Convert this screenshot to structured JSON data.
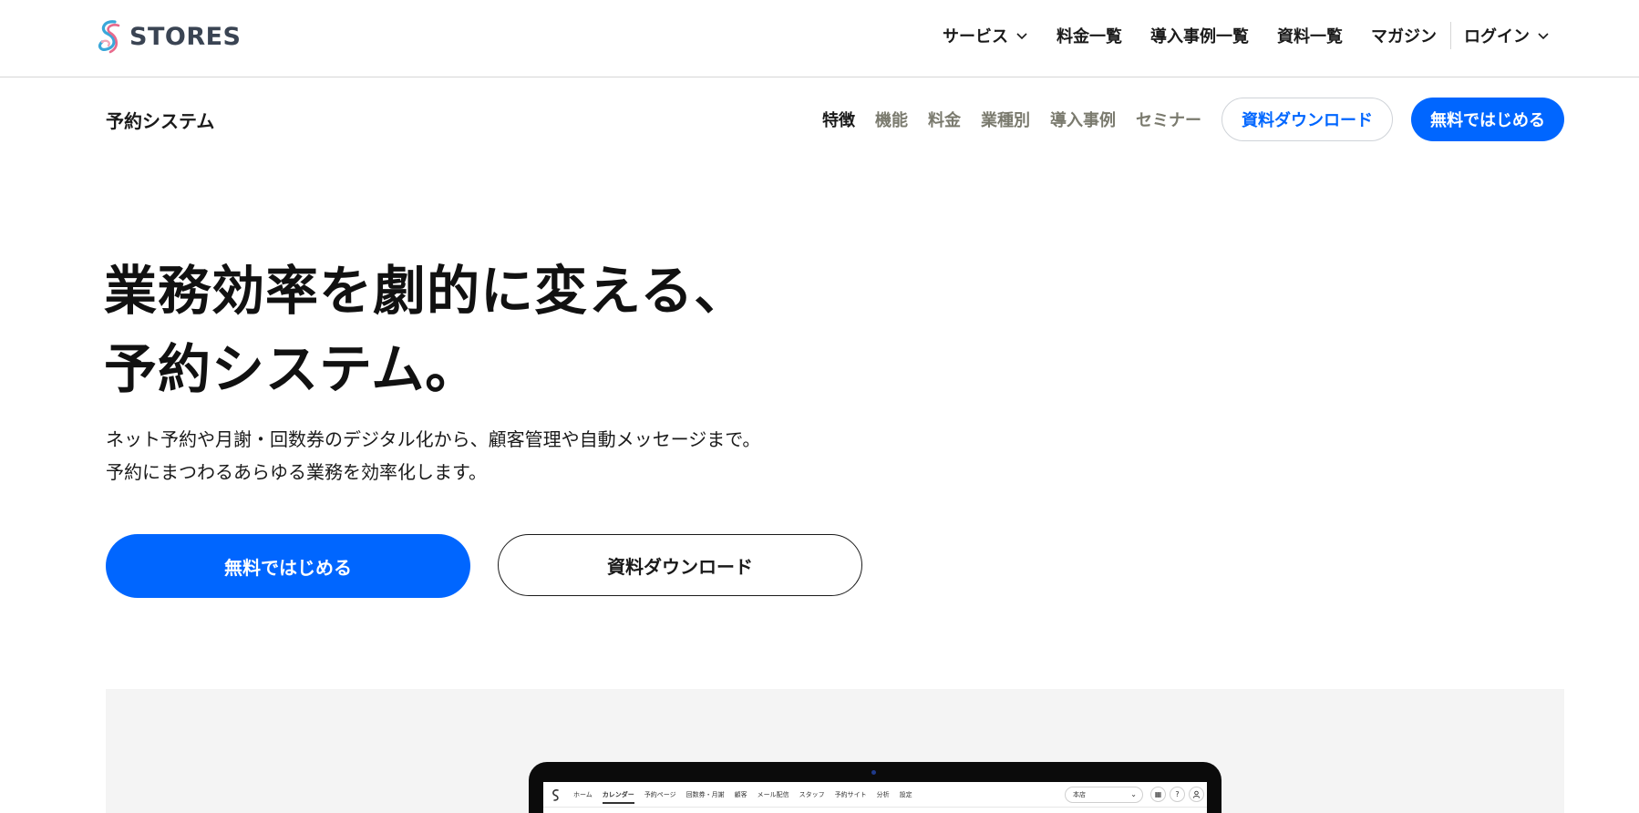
{
  "global_header": {
    "logo_text": "STORES",
    "nav": {
      "service": "サービス",
      "pricing": "料金一覧",
      "cases": "導入事例一覧",
      "documents": "資料一覧",
      "magazine": "マガジン",
      "login": "ログイン"
    }
  },
  "sub_header": {
    "product_name": "予約システム",
    "nav": [
      "特徴",
      "機能",
      "料金",
      "業種別",
      "導入事例",
      "セミナー"
    ],
    "download_label": "資料ダウンロード",
    "start_label": "無料ではじめる"
  },
  "hero": {
    "title_line1": "業務効率を劇的に変える、",
    "title_line2": "予約システム。",
    "desc_line1": "ネット予約や月謝・回数券のデジタル化から、顧客管理や自動メッセージまで。",
    "desc_line2": "予約にまつわるあらゆる業務を効率化します。",
    "primary_button": "無料ではじめる",
    "secondary_button": "資料ダウンロード"
  },
  "app_preview": {
    "tabs": [
      "ホーム",
      "カレンダー",
      "予約ページ",
      "回数券・月謝",
      "顧客",
      "メール配信",
      "スタッフ",
      "予約サイト",
      "分析",
      "設定"
    ],
    "store_select": "本店",
    "help_icon": "?"
  },
  "colors": {
    "accent": "#0066ff",
    "muted_nav": "#7a7a6e",
    "logo_text": "#3a4453",
    "showcase_bg": "#f4f4f4"
  }
}
